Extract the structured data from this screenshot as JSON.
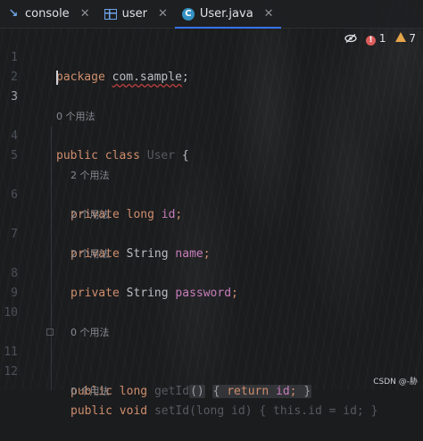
{
  "tabs": [
    {
      "label": "console",
      "icon": "console-icon",
      "active": false
    },
    {
      "label": "user",
      "icon": "table-icon",
      "active": false
    },
    {
      "label": "User.java",
      "icon": "java-class-icon",
      "active": true
    }
  ],
  "inspections": {
    "errors": "1",
    "warnings": "7"
  },
  "editor": {
    "line_numbers": [
      "1",
      "2",
      "3",
      "4",
      "5",
      "6",
      "7",
      "8",
      "9",
      "10",
      "11",
      "12"
    ],
    "hints": {
      "class_usages": "0 个用法",
      "id_usages": "2 个用法",
      "name_usages": "2 个用法",
      "password_usages": "2 个用法",
      "getid_usages": "0 个用法",
      "setid_usages": "0 个用法"
    },
    "line1": {
      "kw": "package",
      "pkg": "com.sample",
      "semi": ";"
    },
    "line4": {
      "kw1": "public",
      "kw2": "class",
      "name": "User",
      "brace": "{"
    },
    "line6": {
      "kw1": "private",
      "kw2": "long",
      "field": "id",
      "semi": ";"
    },
    "line7": {
      "kw1": "private",
      "type": "String",
      "field": "name",
      "semi": ";"
    },
    "line8": {
      "kw1": "private",
      "type": "String",
      "field": "password",
      "semi": ";"
    },
    "line11": {
      "kw1": "public",
      "kw2": "long",
      "method": "getId",
      "parens": "()",
      "open": "{",
      "ret": "return",
      "field": "id",
      "semi": ";",
      "close": "}"
    },
    "line_partial": {
      "kw1": "public",
      "kw2": "void",
      "method": "setId",
      "rest": "(long id) { this.id = id; }"
    }
  },
  "watermark": "CSDN @-胁"
}
